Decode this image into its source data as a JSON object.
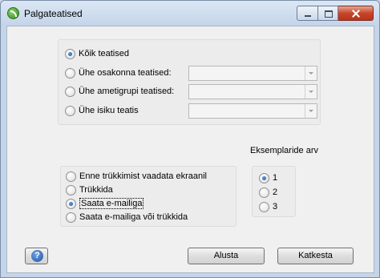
{
  "window": {
    "title": "Palgateatised"
  },
  "scope": {
    "options": [
      {
        "label": "Kõik teatised",
        "checked": true
      },
      {
        "label": "Ühe osakonna teatised:",
        "checked": false
      },
      {
        "label": "Ühe ametigrupi teatised:",
        "checked": false
      },
      {
        "label": "Ühe isiku teatis",
        "checked": false
      }
    ]
  },
  "copies": {
    "heading": "Eksemplaride arv",
    "options": [
      {
        "label": "1",
        "checked": true
      },
      {
        "label": "2",
        "checked": false
      },
      {
        "label": "3",
        "checked": false
      }
    ]
  },
  "output": {
    "options": [
      {
        "label": "Enne trükkimist vaadata ekraanil",
        "checked": false
      },
      {
        "label": "Trükkida",
        "checked": false
      },
      {
        "label": "Saata e-mailiga",
        "checked": true
      },
      {
        "label": "Saata e-mailiga või trükkida",
        "checked": false
      }
    ]
  },
  "buttons": {
    "help_glyph": "?",
    "start_label": "Alusta",
    "cancel_label": "Katkesta"
  },
  "colors": {
    "title_bar": "#c5d5e9",
    "close_button": "#c7452a",
    "client_bg": "#f0f0f0"
  }
}
